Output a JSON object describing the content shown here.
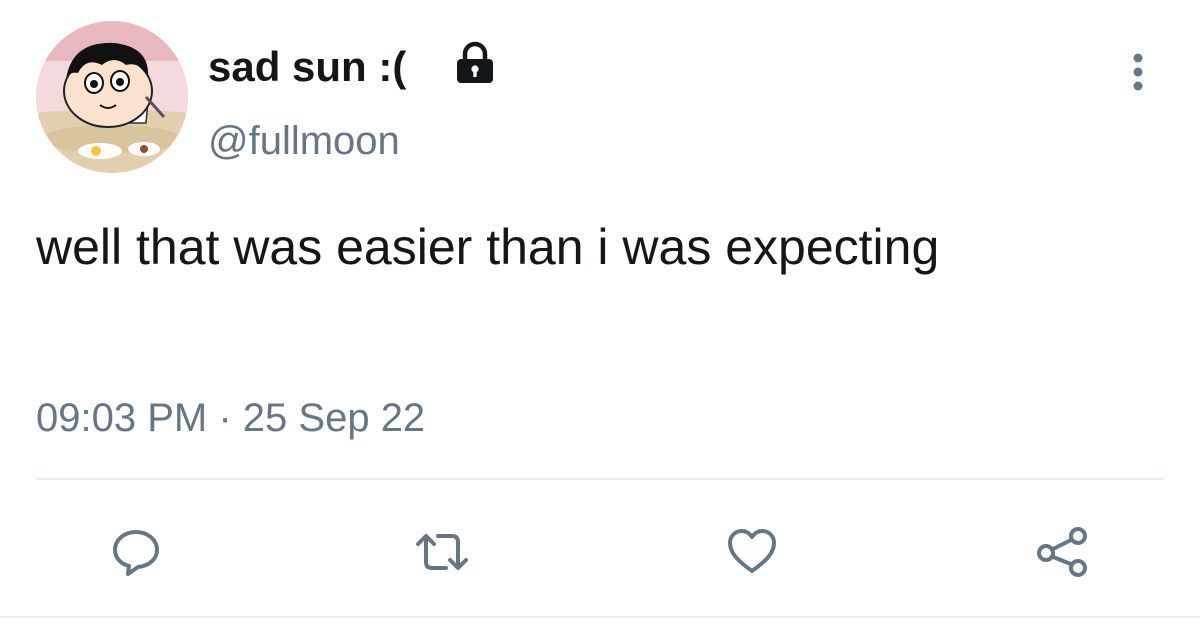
{
  "user": {
    "display_name": "sad sun :(",
    "handle": "@fullmoon",
    "protected": true,
    "avatar": "cartoon-boy-eating-avatar"
  },
  "tweet": {
    "text": "well that was easier than i was expecting",
    "time": "09:03 PM",
    "separator": "·",
    "date": "25 Sep 22"
  },
  "actions": [
    {
      "name": "reply",
      "icon": "speech-bubble-icon"
    },
    {
      "name": "retweet",
      "icon": "retweet-arrows-icon"
    },
    {
      "name": "like",
      "icon": "heart-icon"
    },
    {
      "name": "share",
      "icon": "share-nodes-icon"
    }
  ],
  "colors": {
    "text": "#14171a",
    "secondary": "#657786",
    "icon": "#657786",
    "divider": "#e6ecf0"
  }
}
